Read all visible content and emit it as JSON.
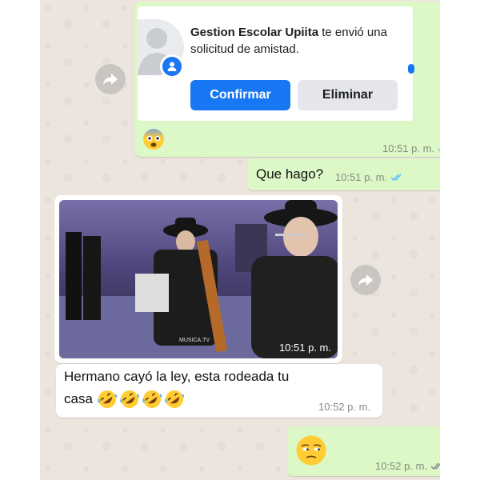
{
  "messages": {
    "friend_request": {
      "sender_name": "Gestion Escolar Upiita",
      "notification_text": " te envió una solicitud de amistad.",
      "confirm_label": "Confirmar",
      "delete_label": "Eliminar",
      "reaction_emoji": "fearful-face",
      "time": "10:51 p. m.",
      "status": "read"
    },
    "que_hago": {
      "text": "Que hago?",
      "time": "10:51 p. m.",
      "status": "read"
    },
    "video": {
      "time": "10:51 p. m.",
      "watermark": "MUSICA.TV"
    },
    "hermano": {
      "text_line1": "Hermano cayó la ley, esta rodeada tu",
      "text_line2": "casa",
      "emojis": [
        "rolling-on-floor-laughing",
        "rolling-on-floor-laughing",
        "rolling-on-floor-laughing",
        "rolling-on-floor-laughing"
      ],
      "time": "10:52 p. m."
    },
    "unamused": {
      "emoji": "unamused-face",
      "time": "10:52 p. m.",
      "status": "delivered"
    }
  },
  "colors": {
    "chat_background": "#ece5dd",
    "outgoing_bubble": "#dcf8c6",
    "incoming_bubble": "#ffffff",
    "read_ticks": "#4fc3f7",
    "facebook_blue": "#1877f2"
  }
}
